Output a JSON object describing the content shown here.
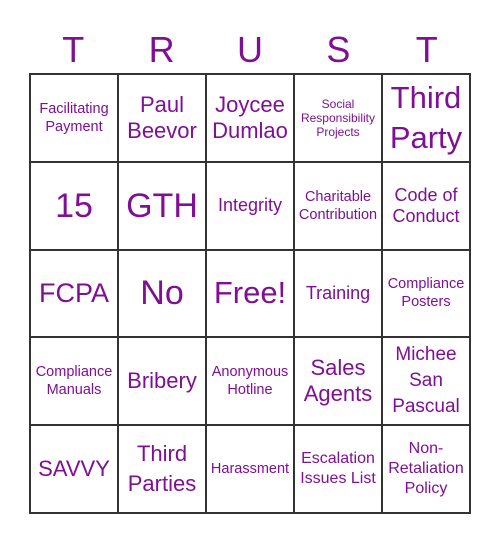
{
  "title_letters": [
    "T",
    "R",
    "U",
    "S",
    "T"
  ],
  "text_color": "#800f96",
  "grid_color": "#333333",
  "cells": [
    [
      "Facilitating Payment",
      "Paul Beevor",
      "Joycee Dumlao",
      "Social Responsibility Projects",
      "Third Party"
    ],
    [
      "15",
      "GTH",
      "Integrity",
      "Charitable Contribution",
      "Code of Conduct"
    ],
    [
      "FCPA",
      "No",
      "Free!",
      "Training",
      "Compliance Posters"
    ],
    [
      "Compliance Manuals",
      "Bribery",
      "Anonymous Hotline",
      "Sales Agents",
      "Michee San Pascual"
    ],
    [
      "SAVVY",
      "Third Parties",
      "Harassment",
      "Escalation Issues List",
      "Non-Retaliation Policy"
    ]
  ]
}
